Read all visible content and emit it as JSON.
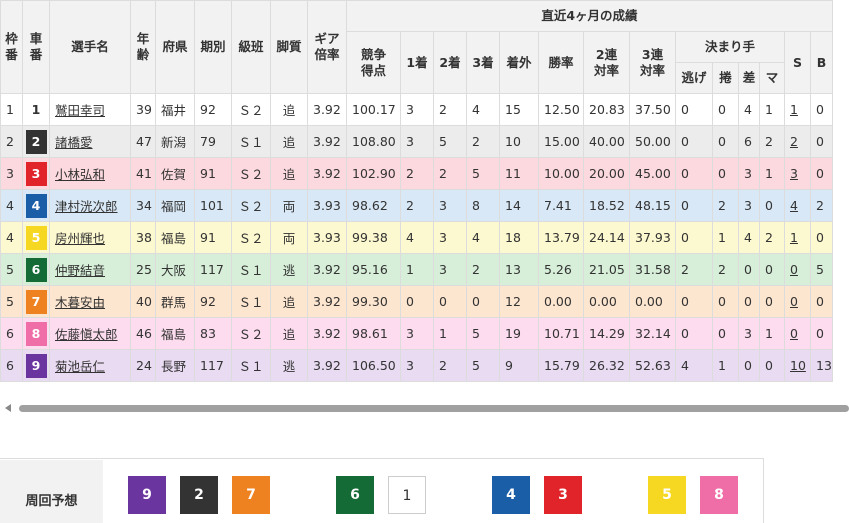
{
  "table": {
    "headers": {
      "waku": "枠番",
      "sha": "車番",
      "name": "選手名",
      "age": "年齢",
      "pref": "府県",
      "term": "期別",
      "class": "級班",
      "style": "脚質",
      "gear": "ギア倍率",
      "recent": "直近4ヶ月の成績",
      "score": "競争得点",
      "first": "1着",
      "second": "2着",
      "third": "3着",
      "out": "着外",
      "win": "勝率",
      "quinella": "2連対率",
      "trio": "3連対率",
      "kimarite": "決まり手",
      "nige": "逃げ",
      "makuri": "捲",
      "sashi": "差",
      "mark": "マ",
      "s": "S",
      "b": "B"
    },
    "rows": [
      {
        "waku": "1",
        "sha": "1",
        "name": "鷲田幸司",
        "age": "39",
        "pref": "福井",
        "term": "92",
        "class": "Ｓ２",
        "style": "追",
        "gear": "3.92",
        "score": "100.17",
        "first": "3",
        "second": "2",
        "third": "4",
        "out": "15",
        "win": "12.50",
        "quinella": "20.83",
        "trio": "37.50",
        "nige": "0",
        "makuri": "0",
        "sashi": "4",
        "mark": "1",
        "s": "1",
        "b": "0",
        "color": "#ffffff"
      },
      {
        "waku": "2",
        "sha": "2",
        "name": "諸橋愛",
        "age": "47",
        "pref": "新潟",
        "term": "79",
        "class": "Ｓ１",
        "style": "追",
        "gear": "3.92",
        "score": "108.80",
        "first": "3",
        "second": "5",
        "third": "2",
        "out": "10",
        "win": "15.00",
        "quinella": "40.00",
        "trio": "50.00",
        "nige": "0",
        "makuri": "0",
        "sashi": "6",
        "mark": "2",
        "s": "2",
        "b": "0",
        "color": "#ececec"
      },
      {
        "waku": "3",
        "sha": "3",
        "name": "小林弘和",
        "age": "41",
        "pref": "佐賀",
        "term": "91",
        "class": "Ｓ２",
        "style": "追",
        "gear": "3.92",
        "score": "102.90",
        "first": "2",
        "second": "2",
        "third": "5",
        "out": "11",
        "win": "10.00",
        "quinella": "20.00",
        "trio": "45.00",
        "nige": "0",
        "makuri": "0",
        "sashi": "3",
        "mark": "1",
        "s": "3",
        "b": "0",
        "color": "#fcd9df"
      },
      {
        "waku": "4",
        "sha": "4",
        "name": "津村洸次郎",
        "age": "34",
        "pref": "福岡",
        "term": "101",
        "class": "Ｓ２",
        "style": "両",
        "gear": "3.93",
        "score": "98.62",
        "first": "2",
        "second": "3",
        "third": "8",
        "out": "14",
        "win": "7.41",
        "quinella": "18.52",
        "trio": "48.15",
        "nige": "0",
        "makuri": "2",
        "sashi": "3",
        "mark": "0",
        "s": "4",
        "b": "2",
        "color": "#d9e8f6"
      },
      {
        "waku": "4",
        "sha": "5",
        "name": "房州輝也",
        "age": "38",
        "pref": "福島",
        "term": "91",
        "class": "Ｓ２",
        "style": "両",
        "gear": "3.93",
        "score": "99.38",
        "first": "4",
        "second": "3",
        "third": "4",
        "out": "18",
        "win": "13.79",
        "quinella": "24.14",
        "trio": "37.93",
        "nige": "0",
        "makuri": "1",
        "sashi": "4",
        "mark": "2",
        "s": "1",
        "b": "0",
        "color": "#fcf8cf"
      },
      {
        "waku": "5",
        "sha": "6",
        "name": "仲野結音",
        "age": "25",
        "pref": "大阪",
        "term": "117",
        "class": "Ｓ１",
        "style": "逃",
        "gear": "3.92",
        "score": "95.16",
        "first": "1",
        "second": "3",
        "third": "2",
        "out": "13",
        "win": "5.26",
        "quinella": "21.05",
        "trio": "31.58",
        "nige": "2",
        "makuri": "2",
        "sashi": "0",
        "mark": "0",
        "s": "0",
        "b": "5",
        "color": "#d7efd9"
      },
      {
        "waku": "5",
        "sha": "7",
        "name": "木暮安由",
        "age": "40",
        "pref": "群馬",
        "term": "92",
        "class": "Ｓ１",
        "style": "追",
        "gear": "3.92",
        "score": "99.30",
        "first": "0",
        "second": "0",
        "third": "0",
        "out": "12",
        "win": "0.00",
        "quinella": "0.00",
        "trio": "0.00",
        "nige": "0",
        "makuri": "0",
        "sashi": "0",
        "mark": "0",
        "s": "0",
        "b": "0",
        "color": "#fde6cf"
      },
      {
        "waku": "6",
        "sha": "8",
        "name": "佐藤愼太郎",
        "age": "46",
        "pref": "福島",
        "term": "83",
        "class": "Ｓ２",
        "style": "追",
        "gear": "3.92",
        "score": "98.61",
        "first": "3",
        "second": "1",
        "third": "5",
        "out": "19",
        "win": "10.71",
        "quinella": "14.29",
        "trio": "32.14",
        "nige": "0",
        "makuri": "0",
        "sashi": "3",
        "mark": "1",
        "s": "0",
        "b": "0",
        "color": "#fcdcee"
      },
      {
        "waku": "6",
        "sha": "9",
        "name": "菊池岳仁",
        "age": "24",
        "pref": "長野",
        "term": "117",
        "class": "Ｓ１",
        "style": "逃",
        "gear": "3.92",
        "score": "106.50",
        "first": "3",
        "second": "2",
        "third": "5",
        "out": "9",
        "win": "15.79",
        "quinella": "26.32",
        "trio": "52.63",
        "nige": "4",
        "makuri": "1",
        "sashi": "0",
        "mark": "0",
        "s": "10",
        "b": "13",
        "color": "#e8dbf2"
      }
    ]
  },
  "forecast": {
    "label": "周回予想",
    "boxes": [
      {
        "num": "9",
        "color": "#6b35a0",
        "text": "#ffffff"
      },
      {
        "num": "2",
        "color": "#333333",
        "text": "#ffffff"
      },
      {
        "num": "7",
        "color": "#ef8220",
        "text": "#ffffff"
      },
      {
        "num": "6",
        "color": "#146b36",
        "text": "#ffffff"
      },
      {
        "num": "1",
        "color": "#ffffff",
        "text": "#333333"
      },
      {
        "num": "4",
        "color": "#1a5ea8",
        "text": "#ffffff"
      },
      {
        "num": "3",
        "color": "#e0242a",
        "text": "#ffffff"
      },
      {
        "num": "5",
        "color": "#f6d823",
        "text": "#ffffff"
      },
      {
        "num": "8",
        "color": "#f06ea8",
        "text": "#ffffff"
      }
    ]
  }
}
